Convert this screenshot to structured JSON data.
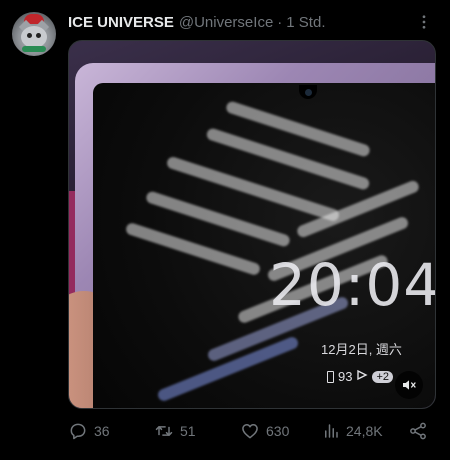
{
  "author": {
    "name": "ICE UNIVERSE",
    "handle": "@UniverseIce",
    "separator": "·",
    "time": "1 Std."
  },
  "media": {
    "clock_text": "20:04",
    "date_text": "12月2日, 週六",
    "battery_text": "93",
    "notification_badge": "+2",
    "mute_icon": "speaker-muted-icon"
  },
  "actions": {
    "replies": "36",
    "retweets": "51",
    "likes": "630",
    "views": "24,8K"
  },
  "colors": {
    "background": "#000000",
    "text_primary": "#e7e9ea",
    "text_secondary": "#71767b"
  }
}
